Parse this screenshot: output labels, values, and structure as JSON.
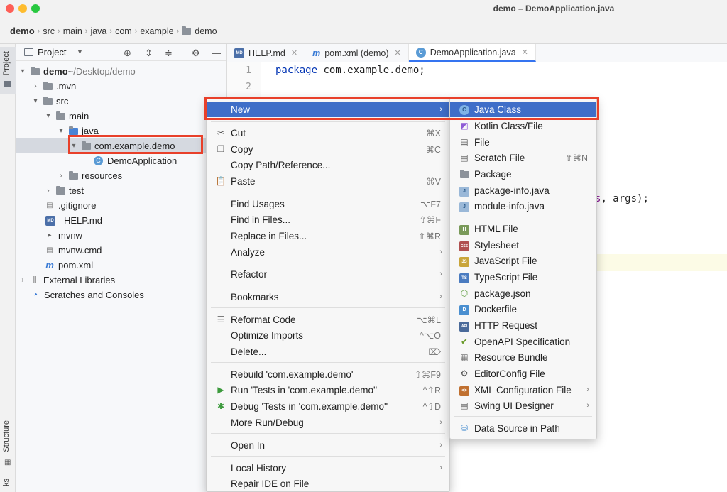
{
  "window": {
    "title": "demo – DemoApplication.java"
  },
  "breadcrumb": [
    "demo",
    "src",
    "main",
    "java",
    "com",
    "example",
    "demo"
  ],
  "sidebar_tabs": {
    "project": "Project",
    "structure": "Structure",
    "bookmarks": "ks"
  },
  "project_panel": {
    "title": "Project",
    "tree": [
      {
        "label": "demo",
        "detail": " ~/Desktop/demo"
      },
      {
        "label": ".mvn"
      },
      {
        "label": "src"
      },
      {
        "label": "main"
      },
      {
        "label": "java"
      },
      {
        "label": "com.example.demo"
      },
      {
        "label": "DemoApplication"
      },
      {
        "label": "resources"
      },
      {
        "label": "test"
      },
      {
        "label": ".gitignore"
      },
      {
        "label": "HELP.md"
      },
      {
        "label": "mvnw"
      },
      {
        "label": "mvnw.cmd"
      },
      {
        "label": "pom.xml"
      },
      {
        "label": "External Libraries"
      },
      {
        "label": "Scratches and Consoles"
      }
    ]
  },
  "editor": {
    "tabs": [
      {
        "label": "HELP.md",
        "icon": "MD"
      },
      {
        "label": "pom.xml (demo)",
        "icon": "m"
      },
      {
        "label": "DemoApplication.java",
        "icon": "C"
      }
    ],
    "lines": [
      {
        "num": "1",
        "kw": "package",
        "text": " com.example.demo;"
      },
      {
        "num": "2",
        "kw": "",
        "text": ""
      }
    ],
    "fragment": "s, args);"
  },
  "context_menu": {
    "new": "New",
    "cut": {
      "label": "Cut",
      "shortcut": "⌘X"
    },
    "copy": {
      "label": "Copy",
      "shortcut": "⌘C"
    },
    "copy_path": {
      "label": "Copy Path/Reference..."
    },
    "paste": {
      "label": "Paste",
      "shortcut": "⌘V"
    },
    "find_usages": {
      "label": "Find Usages",
      "shortcut": "⌥F7"
    },
    "find_in_files": {
      "label": "Find in Files...",
      "shortcut": "⇧⌘F"
    },
    "replace_in_files": {
      "label": "Replace in Files...",
      "shortcut": "⇧⌘R"
    },
    "analyze": {
      "label": "Analyze"
    },
    "refactor": {
      "label": "Refactor"
    },
    "bookmarks": {
      "label": "Bookmarks"
    },
    "reformat": {
      "label": "Reformat Code",
      "shortcut": "⌥⌘L"
    },
    "optimize": {
      "label": "Optimize Imports",
      "shortcut": "^⌥O"
    },
    "delete": {
      "label": "Delete...",
      "shortcut": "⌦"
    },
    "rebuild": {
      "label": "Rebuild 'com.example.demo'",
      "shortcut": "⇧⌘F9"
    },
    "run": {
      "label": "Run 'Tests in 'com.example.demo''",
      "shortcut": "^⇧R"
    },
    "debug": {
      "label": "Debug 'Tests in 'com.example.demo''",
      "shortcut": "^⇧D"
    },
    "more_run": {
      "label": "More Run/Debug"
    },
    "open_in": {
      "label": "Open In"
    },
    "local_history": {
      "label": "Local History"
    },
    "repair": {
      "label": "Repair IDE on File"
    }
  },
  "new_submenu": {
    "java_class": "Java Class",
    "kotlin": "Kotlin Class/File",
    "file": "File",
    "scratch": {
      "label": "Scratch File",
      "shortcut": "⇧⌘N"
    },
    "package": "Package",
    "package_info": "package-info.java",
    "module_info": "module-info.java",
    "html": "HTML File",
    "stylesheet": "Stylesheet",
    "js": "JavaScript File",
    "ts": "TypeScript File",
    "package_json": "package.json",
    "dockerfile": "Dockerfile",
    "http": "HTTP Request",
    "openapi": "OpenAPI Specification",
    "resource_bundle": "Resource Bundle",
    "editorconfig": "EditorConfig File",
    "xml_config": "XML Configuration File",
    "swing": "Swing UI Designer",
    "datasource": "Data Source in Path"
  },
  "icon_text": {
    "md": "MD",
    "h": "H",
    "css": "CSS",
    "js": "JS",
    "ts": "TS",
    "d": "D",
    "api": "API",
    "j": "J"
  }
}
